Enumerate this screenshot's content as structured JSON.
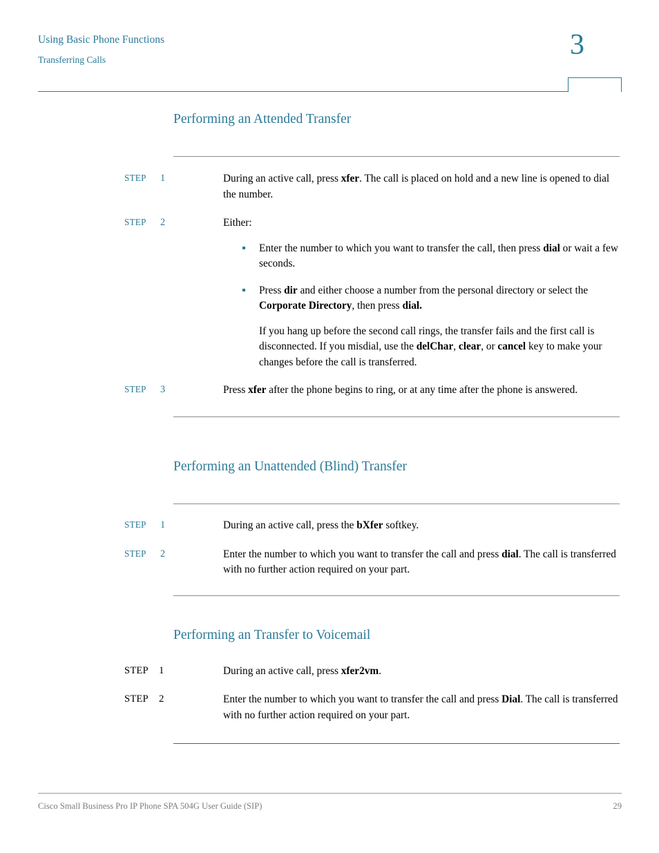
{
  "colors": {
    "accent": "#2a7a99",
    "rule": "#8c8c8c",
    "footer_text": "#7d7d7d",
    "body_text": "#000000"
  },
  "header": {
    "chapter_title": "Using Basic Phone Functions",
    "section_title": "Transferring Calls",
    "chapter_number": "3"
  },
  "sections": [
    {
      "heading": "Performing an Attended Transfer",
      "steps": [
        {
          "label": "STEP",
          "number": "1",
          "body_html": "During an active call, press <b>xfer</b>. The call is placed on hold and a new line is opened to dial the number."
        },
        {
          "label": "STEP",
          "number": "2",
          "body_html": "Either:",
          "bullets": [
            "Enter the number to which you want to transfer the call, then press <b>dial</b> or wait a few seconds.",
            "Press <b>dir</b> and either choose a number from the personal directory or select the <b>Corporate Directory</b>, then press <b>dial.</b>"
          ],
          "sub_paragraph_html": "If you hang up before the second call rings, the transfer fails and the first call is disconnected. If you misdial, use the <b>delChar</b>, <b>clear</b>, or <b>cancel</b> key to make your changes before the call is transferred."
        },
        {
          "label": "STEP",
          "number": "3",
          "body_html": "Press <b>xfer</b> after the phone begins to ring, or at any time after the phone is answered."
        }
      ]
    },
    {
      "heading": "Performing an Unattended (Blind) Transfer",
      "steps": [
        {
          "label": "STEP",
          "number": "1",
          "body_html": "During an active call, press the <b>bXfer</b> softkey."
        },
        {
          "label": "STEP",
          "number": "2",
          "body_html": "Enter the number to which you want to transfer the call and press <b>dial</b>. The call is transferred with no further action required on your part."
        }
      ]
    },
    {
      "heading": "Performing an Transfer to Voicemail",
      "steps": [
        {
          "label": "STEP",
          "number": "1",
          "body_html": "During an active call, press <b>xfer2vm</b>."
        },
        {
          "label": "STEP",
          "number": "2",
          "body_html": "Enter the number to which you want to transfer the call and press <b>Dial</b>. The call is transferred with no further action required on your part."
        }
      ]
    }
  ],
  "footer": {
    "document_title": "Cisco Small Business Pro IP Phone SPA 504G User Guide (SIP)",
    "page_number": "29"
  }
}
